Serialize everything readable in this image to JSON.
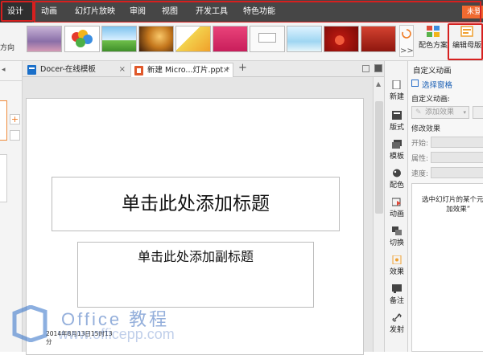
{
  "menubar": {
    "tabs": [
      "设计",
      "动画",
      "幻灯片放映",
      "审阅",
      "视图",
      "开发工具",
      "特色功能"
    ],
    "user_button": "未登"
  },
  "ribbon": {
    "more_label": ">>",
    "color_scheme_label": "配色方案",
    "edit_master_label": "编辑母版"
  },
  "left_panel": {
    "label": "方向"
  },
  "doc_tabs": [
    {
      "label": "Docer-在线模板",
      "close": "×"
    },
    {
      "label": "新建 Micro...灯片.ppt *",
      "close": "×"
    }
  ],
  "new_tab_label": "+",
  "slide": {
    "title_placeholder": "单击此处添加标题",
    "subtitle_placeholder": "单击此处添加副标题",
    "date_line1": "2014年8月13日15时13",
    "date_line2": "分"
  },
  "sidebar": {
    "items": [
      "新建",
      "版式",
      "模板",
      "配色",
      "动画",
      "切换",
      "效果",
      "备注",
      "发射"
    ]
  },
  "task_pane": {
    "title": "自定义动画",
    "select_pane": "选择窗格",
    "custom_animation": "自定义动画:",
    "add_effect": "添加效果",
    "modify_effect": "修改效果",
    "start_label": "开始:",
    "property_label": "属性:",
    "speed_label": "速度:",
    "hint_line1": "选中幻灯片的某个元",
    "hint_line2": "加效果”"
  },
  "watermark": {
    "brand": "Office 教程",
    "url": "www.officepp.com"
  }
}
